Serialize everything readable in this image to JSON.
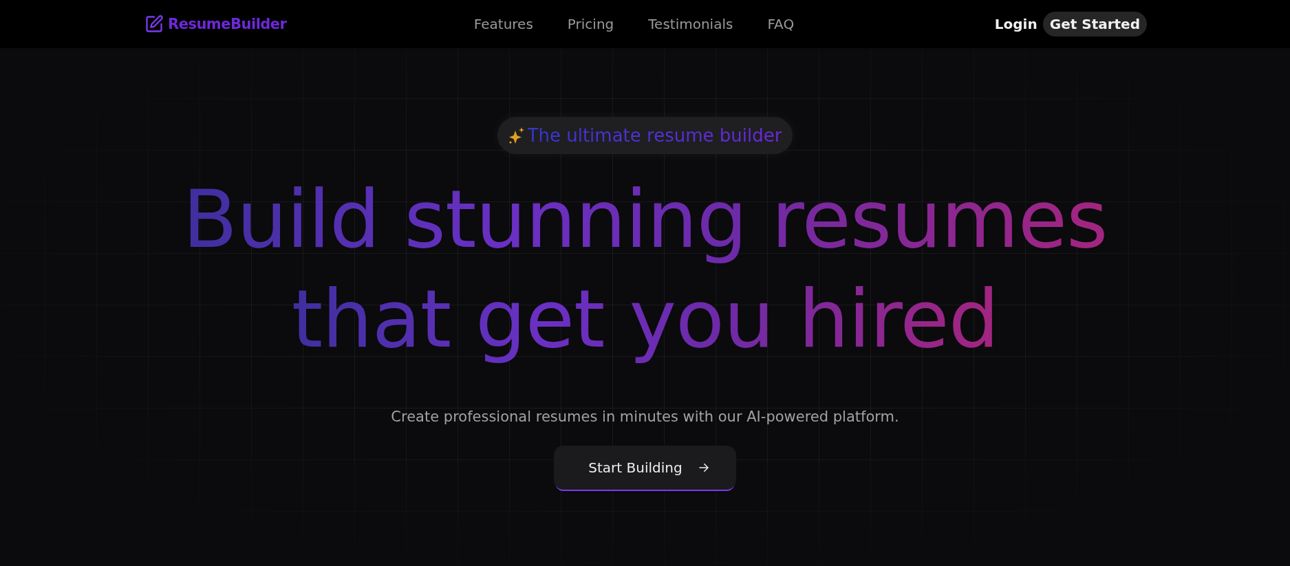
{
  "header": {
    "logo": "ResumeBuilder",
    "nav": [
      {
        "label": "Features"
      },
      {
        "label": "Pricing"
      },
      {
        "label": "Testimonials"
      },
      {
        "label": "FAQ"
      }
    ],
    "login": "Login",
    "cta": "Get Started"
  },
  "hero": {
    "badge": "The ultimate resume builder",
    "headline": [
      "Build stunning resumes",
      "that get you hired"
    ],
    "subtitle": "Create professional resumes in minutes with our AI-powered platform.",
    "button": "Start Building"
  }
}
